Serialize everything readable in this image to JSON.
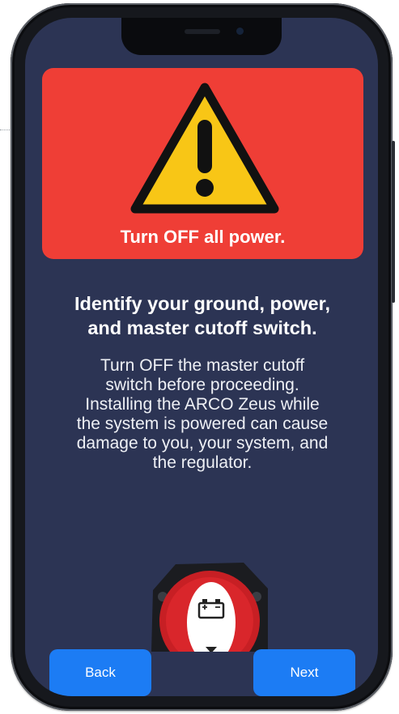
{
  "warning": {
    "icon": "warning-triangle-icon",
    "text": "Turn OFF all power."
  },
  "headline": {
    "line1": "Identify your ground, power,",
    "line2": "and master cutoff switch."
  },
  "body": {
    "lines": [
      "Turn OFF the master cutoff",
      "switch before proceeding.",
      "Installing the ARCO Zeus while",
      "the system is powered can cause",
      "damage to you, your system, and",
      "the regulator."
    ]
  },
  "image": {
    "icon": "battery-icon"
  },
  "nav": {
    "back_label": "Back",
    "next_label": "Next"
  },
  "colors": {
    "screen_bg": "#2c3454",
    "warning_bg": "#ef3e36",
    "warning_yellow": "#f8c616",
    "button_blue": "#1c7cf4"
  }
}
